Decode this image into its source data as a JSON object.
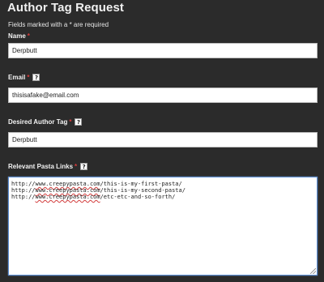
{
  "form": {
    "title": "Author Tag Request",
    "required_note": "Fields marked with a * are required",
    "required_marker": "*",
    "help_symbol": "?"
  },
  "fields": {
    "name": {
      "label": "Name",
      "value": "Derpbutt"
    },
    "email": {
      "label": "Email",
      "value": "thisisafake@email.com"
    },
    "author_tag": {
      "label": "Desired Author Tag",
      "value": "Derpbutt"
    },
    "pasta_links": {
      "label": "Relevant Pasta Links",
      "lines": [
        {
          "prefix": "http://",
          "domain": "www.creepypasta.com",
          "path": "/this-is-my-first-pasta/"
        },
        {
          "prefix": "http://",
          "domain": "www.creepypasta.com",
          "path": "/this-is-my-second-pasta/"
        },
        {
          "prefix": "http://",
          "domain": "www.creepypasta.com",
          "path": "/etc-etc-and-so-forth/"
        }
      ]
    }
  },
  "colors": {
    "background": "#2b2b2b",
    "required_star": "#d93a3a",
    "focus_border": "#5c8fd6"
  }
}
